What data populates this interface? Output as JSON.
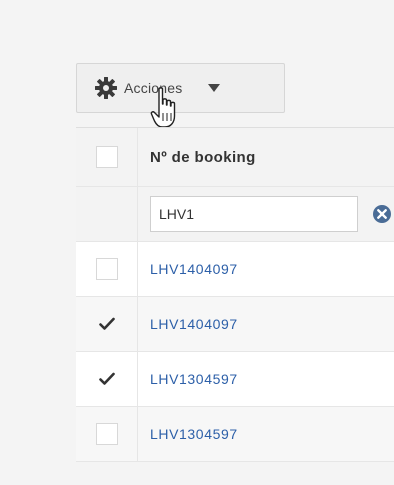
{
  "toolbar": {
    "actions_label": "Acciones",
    "icons": {
      "actions": "gear-icon",
      "dropdown": "caret-down-icon",
      "pointer": "hand-pointer-icon"
    }
  },
  "table": {
    "columns": [
      {
        "label": "Nº de booking"
      }
    ],
    "filter": {
      "value": "LHV1",
      "clear_icon": "clear-icon"
    },
    "rows": [
      {
        "booking": "LHV1404097",
        "checked": false
      },
      {
        "booking": "LHV1404097",
        "checked": true
      },
      {
        "booking": "LHV1304597",
        "checked": true
      },
      {
        "booking": "LHV1304597",
        "checked": false
      }
    ]
  },
  "colors": {
    "link": "#2c5fa8",
    "clear_icon": "#4a6c96",
    "header_bg": "#f3f3f3"
  }
}
